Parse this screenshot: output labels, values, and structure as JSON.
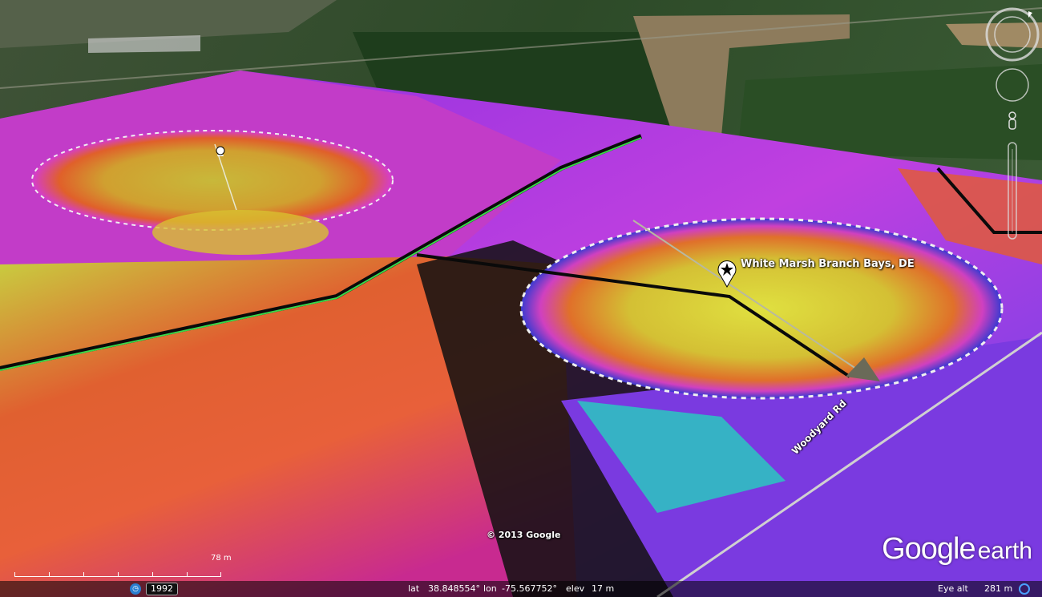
{
  "map": {
    "placemark_label": "White Marsh Branch Bays, DE",
    "road_label": "Woodyard Rd",
    "copyright": "© 2013 Google",
    "brand_google": "Google",
    "brand_earth": "earth",
    "scale_label": "78 m"
  },
  "status": {
    "year": "1992",
    "lat_label": "lat",
    "lat": "38.848554°",
    "lon_label": "lon",
    "lon": "-75.567752°",
    "elev_label": "elev",
    "elev": "17 m",
    "eye_label": "Eye alt",
    "eye": "281 m"
  },
  "colors": {
    "field": "#5e6b3e",
    "forest": "#1f4a1f",
    "runway": "#8c7a5a",
    "magenta": "#d43cd0",
    "yellow": "#d8d83a",
    "orange": "#e8602a",
    "cyan": "#3ad8c8"
  },
  "icons": [
    "placemark-pin-icon",
    "star-placemark-icon",
    "history-clock-icon",
    "loading-spinner-icon",
    "compass-ring-icon",
    "look-joystick-icon",
    "street-view-pegman-icon",
    "zoom-slider-icon"
  ]
}
